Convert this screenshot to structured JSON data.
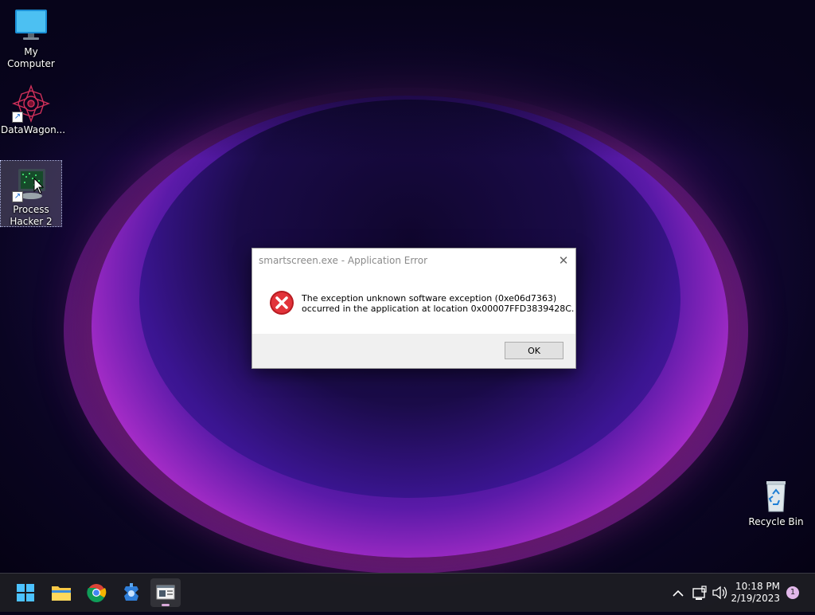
{
  "desktop": {
    "icons": [
      {
        "label": "My Computer"
      },
      {
        "label": "DataWagon..."
      },
      {
        "label": "Process Hacker 2"
      },
      {
        "label": "Recycle Bin"
      }
    ]
  },
  "dialog": {
    "title": "smartscreen.exe - Application Error",
    "message_line1": "The exception unknown software exception (0xe06d7363)",
    "message_line2": "occurred in the application at location 0x00007FFD3839428C.",
    "ok_label": "OK",
    "close_icon": "close-icon",
    "error_icon": "error-icon"
  },
  "taskbar": {
    "apps": [
      {
        "icon": "start-icon"
      },
      {
        "icon": "file-explorer-icon"
      },
      {
        "icon": "chrome-icon"
      },
      {
        "icon": "settings-app-icon"
      },
      {
        "icon": "application-window-icon"
      }
    ],
    "tray": {
      "chevron_icon": "chevron-up-icon",
      "network_icon": "network-icon",
      "volume_icon": "volume-icon",
      "time": "10:18 PM",
      "date": "2/19/2023",
      "notification_count": "1"
    }
  },
  "colors": {
    "accent": "#0078d4",
    "error_red": "#d9262e"
  }
}
